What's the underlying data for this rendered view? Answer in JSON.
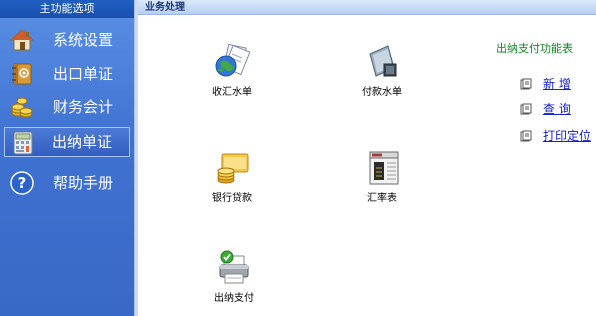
{
  "sidebar": {
    "header": "主功能选项",
    "items": [
      {
        "label": "系统设置",
        "icon": "house-icon"
      },
      {
        "label": "出口单证",
        "icon": "address-book-icon"
      },
      {
        "label": "财务会计",
        "icon": "coins-icon"
      },
      {
        "label": "出纳单证",
        "icon": "calculator-icon",
        "active": true
      },
      {
        "label": "帮助手册",
        "icon": "help-icon"
      }
    ]
  },
  "main": {
    "header": "业务处理",
    "modules": [
      {
        "label": "收汇水单",
        "icon": "globe-document-icon"
      },
      {
        "label": "付款水单",
        "icon": "payment-document-icon"
      },
      {
        "label": "银行贷款",
        "icon": "bank-loan-icon"
      },
      {
        "label": "汇率表",
        "icon": "exchange-rate-table-icon"
      },
      {
        "label": "出纳支付",
        "icon": "printer-check-icon"
      }
    ]
  },
  "functions": {
    "title": "出纳支付功能表",
    "links": [
      {
        "label": "新 增"
      },
      {
        "label": "查 询"
      },
      {
        "label": "打印定位"
      }
    ]
  },
  "colors": {
    "sidebar_bg": "#4579d6",
    "header_bg": "#1f5fc2",
    "function_title": "#0a8a23",
    "link": "#1420cc"
  }
}
